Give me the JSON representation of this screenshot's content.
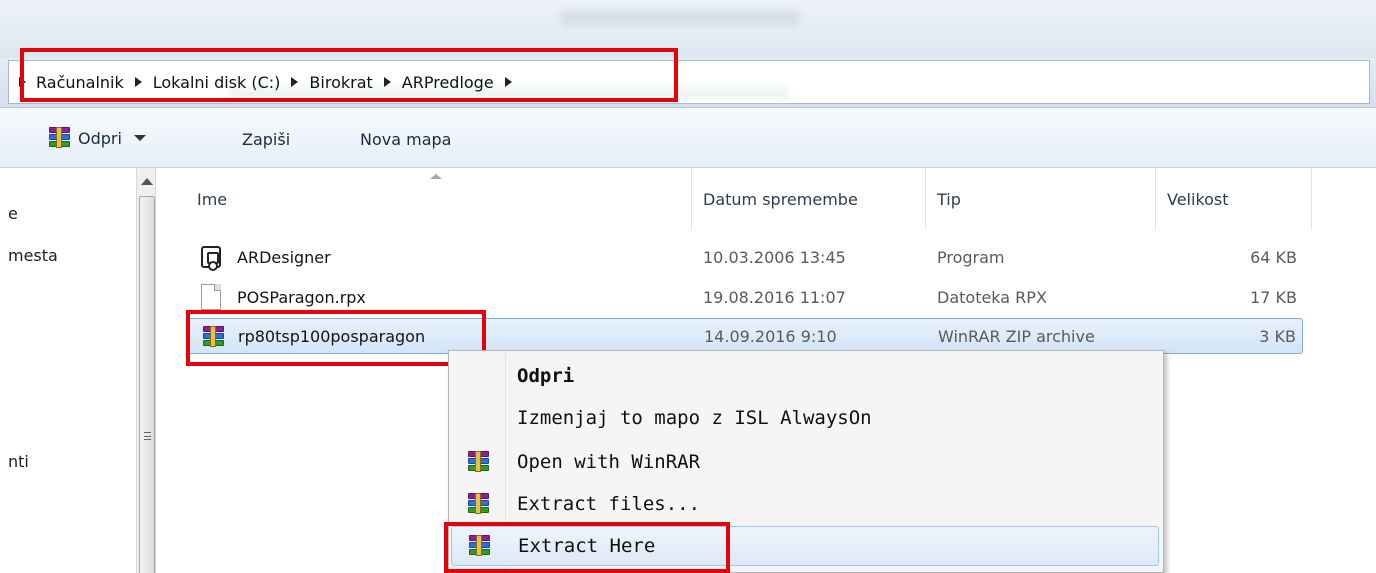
{
  "address": {
    "crumbs": [
      "Računalnik",
      "Lokalni disk (C:)",
      "Birokrat",
      "ARPredloge"
    ]
  },
  "toolbar": {
    "open_label": "Odpri",
    "save_label": "Zapiši",
    "new_folder_label": "Nova mapa"
  },
  "nav": {
    "items": [
      "e",
      "mesta",
      "nti"
    ]
  },
  "columns": {
    "name": "Ime",
    "date": "Datum spremembe",
    "type": "Tip",
    "size": "Velikost"
  },
  "files": [
    {
      "name": "ARDesigner",
      "date": "10.03.2006 13:45",
      "type": "Program",
      "size": "64 KB",
      "icon": "exe-icon"
    },
    {
      "name": "POSParagon.rpx",
      "date": "19.08.2016 11:07",
      "type": "Datoteka RPX",
      "size": "17 KB",
      "icon": "document-icon"
    },
    {
      "name": "rp80tsp100posparagon",
      "date": "14.09.2016 9:10",
      "type": "WinRAR ZIP archive",
      "size": "3 KB",
      "icon": "winrar-archive-icon"
    }
  ],
  "context_menu": {
    "items": [
      "Odpri",
      "Izmenjaj to mapo z ISL AlwaysOn",
      "Open with WinRAR",
      "Extract files...",
      "Extract Here"
    ]
  },
  "colors": {
    "highlight_box": "#e3040b",
    "selection": "#d2e4f7"
  }
}
